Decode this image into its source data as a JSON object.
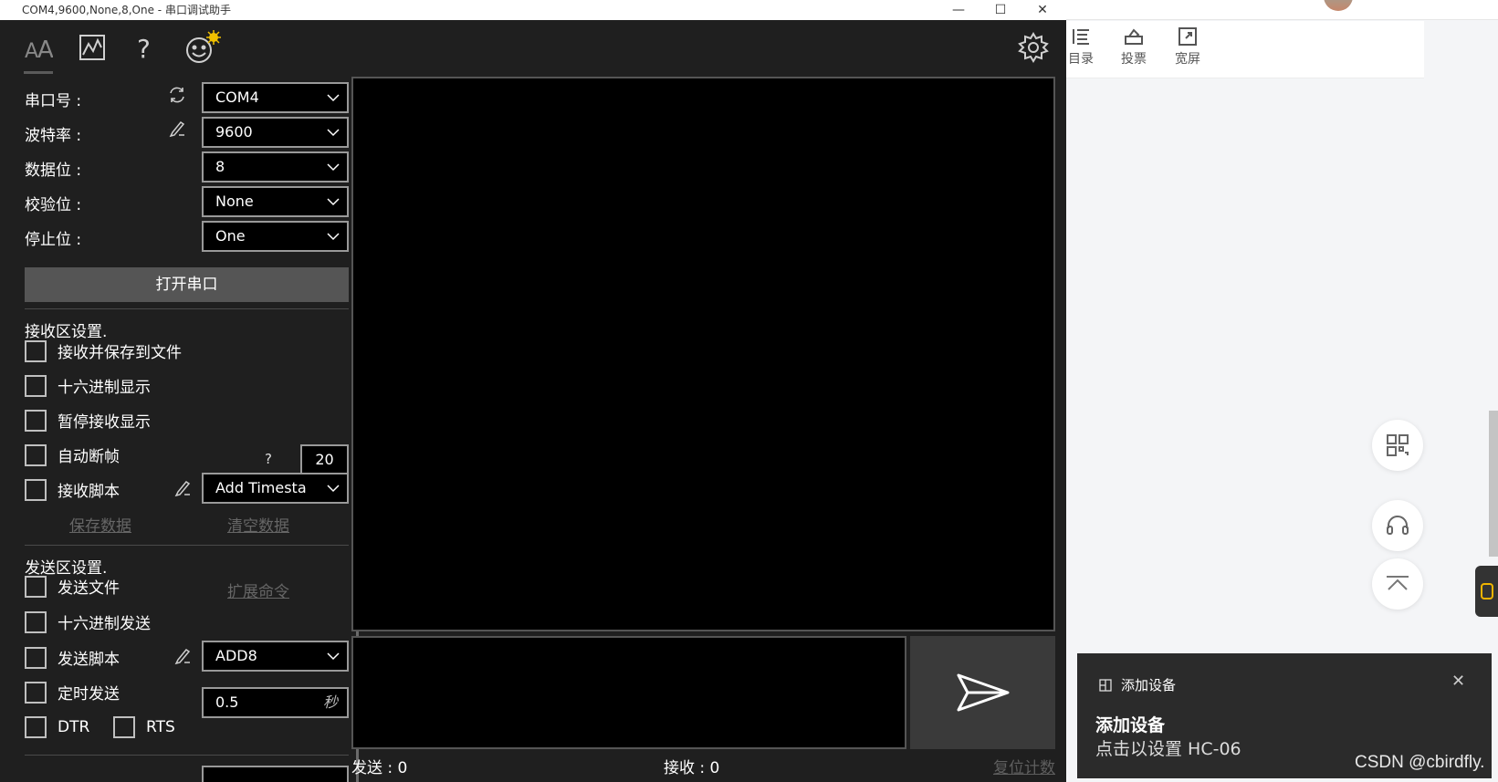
{
  "window": {
    "title": "COM4,9600,None,8,One - 串口调试助手",
    "minimize": "—",
    "maximize": "☐",
    "close": "✕"
  },
  "toolbar": {
    "icons": [
      "font-icon",
      "chart-icon",
      "help-icon",
      "emoji-icon",
      "settings-icon"
    ]
  },
  "serial": {
    "port_label": "串口号 :",
    "port_value": "COM4",
    "baud_label": "波特率 :",
    "baud_value": "9600",
    "databits_label": "数据位 :",
    "databits_value": "8",
    "parity_label": "校验位 :",
    "parity_value": "None",
    "stopbits_label": "停止位 :",
    "stopbits_value": "One",
    "open_button": "打开串口"
  },
  "receive": {
    "title": "接收区设置.",
    "save_to_file": "接收并保存到文件",
    "hex_display": "十六进制显示",
    "pause_display": "暂停接收显示",
    "auto_frame": "自动断帧",
    "auto_frame_help": "?",
    "auto_frame_value": "20",
    "script": "接收脚本",
    "script_value": "Add Timesta",
    "save_data": "保存数据",
    "clear_data": "清空数据"
  },
  "send": {
    "title": "发送区设置.",
    "send_file": "发送文件",
    "extend_cmd": "扩展命令",
    "hex_send": "十六进制发送",
    "script": "发送脚本",
    "script_value": "ADD8",
    "timed_send": "定时发送",
    "interval_value": "0.5",
    "interval_unit": "秒",
    "dtr": "DTR",
    "rts": "RTS"
  },
  "status": {
    "sent": "发送 : 0",
    "received": "接收 : 0",
    "reset": "复位计数"
  },
  "browser": {
    "toc": "目录",
    "vote": "投票",
    "widescreen": "宽屏"
  },
  "toast": {
    "app_name": "添加设备",
    "title": "添加设备",
    "body": "点击以设置 HC-06",
    "close": "✕"
  },
  "watermark": "CSDN @cbirdfly."
}
